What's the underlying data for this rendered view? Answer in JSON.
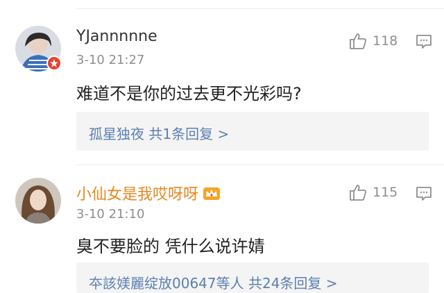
{
  "comments": [
    {
      "username": "YJannnnne",
      "time": "3-10 21:27",
      "likes": "118",
      "text": "难道不是你的过去更不光彩吗?",
      "reply_preview": "孤星独夜  共1条回复 >",
      "username_color": "#333333",
      "badge": "red-flower-badge"
    },
    {
      "username": "小仙女是我哎呀呀",
      "time": "3-10 21:10",
      "likes": "115",
      "text": "臭不要脸的   凭什么说许婧",
      "reply_preview": "夲該媄麗绽放00647等人  共24条回复 >",
      "username_color": "#e8871e",
      "badge": "crown-icon"
    }
  ],
  "colors": {
    "link": "#5b7fb0",
    "muted": "#8e8e8e",
    "reply_bg": "#f4f4f4",
    "vip": "#e8871e"
  }
}
